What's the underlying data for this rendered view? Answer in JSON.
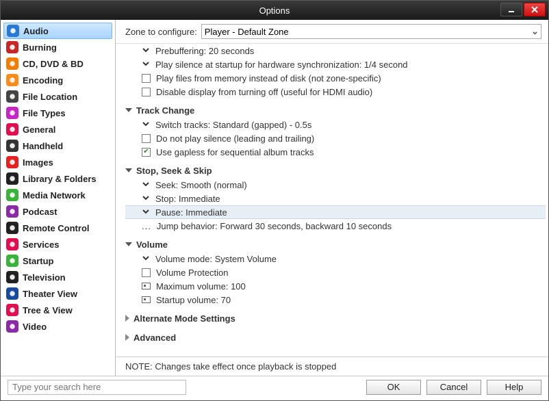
{
  "window": {
    "title": "Options"
  },
  "sidebar": {
    "items": [
      {
        "label": "Audio",
        "icon": "audio",
        "selected": true,
        "bg": "#2a7ad4"
      },
      {
        "label": "Burning",
        "icon": "burning",
        "bg": "#c62828"
      },
      {
        "label": "CD, DVD & BD",
        "icon": "disc",
        "bg": "#f57c00"
      },
      {
        "label": "Encoding",
        "icon": "encoding",
        "bg": "#ff8c1a"
      },
      {
        "label": "File Location",
        "icon": "file-location",
        "bg": "#444"
      },
      {
        "label": "File Types",
        "icon": "file-types",
        "bg": "#c526c5"
      },
      {
        "label": "General",
        "icon": "general",
        "bg": "#e01050"
      },
      {
        "label": "Handheld",
        "icon": "handheld",
        "bg": "#333"
      },
      {
        "label": "Images",
        "icon": "images",
        "bg": "#e52222"
      },
      {
        "label": "Library & Folders",
        "icon": "library",
        "bg": "#222"
      },
      {
        "label": "Media Network",
        "icon": "media-network",
        "bg": "#3ab33a"
      },
      {
        "label": "Podcast",
        "icon": "podcast",
        "bg": "#8a2aa8"
      },
      {
        "label": "Remote Control",
        "icon": "remote",
        "bg": "#222"
      },
      {
        "label": "Services",
        "icon": "services",
        "bg": "#e01050"
      },
      {
        "label": "Startup",
        "icon": "startup",
        "bg": "#3ab33a"
      },
      {
        "label": "Television",
        "icon": "television",
        "bg": "#222"
      },
      {
        "label": "Theater View",
        "icon": "theater",
        "bg": "#1a4aa0"
      },
      {
        "label": "Tree & View",
        "icon": "tree",
        "bg": "#e01050"
      },
      {
        "label": "Video",
        "icon": "video",
        "bg": "#8a2aa8"
      }
    ]
  },
  "zone": {
    "label": "Zone to configure:",
    "value": "Player - Default Zone"
  },
  "settings": {
    "loose": [
      {
        "type": "expand",
        "text": "Prebuffering: 20 seconds"
      },
      {
        "type": "expand",
        "text": "Play silence at startup for hardware synchronization: 1/4 second"
      },
      {
        "type": "check",
        "checked": false,
        "text": "Play files from memory instead of disk (not zone-specific)"
      },
      {
        "type": "check",
        "checked": false,
        "text": "Disable display from turning off (useful for HDMI audio)"
      }
    ],
    "groups": [
      {
        "title": "Track Change",
        "open": true,
        "rows": [
          {
            "type": "expand",
            "text": "Switch tracks: Standard (gapped) - 0.5s"
          },
          {
            "type": "check",
            "checked": false,
            "text": "Do not play silence (leading and trailing)"
          },
          {
            "type": "check",
            "checked": true,
            "text": "Use gapless for sequential album tracks"
          }
        ]
      },
      {
        "title": "Stop, Seek & Skip",
        "open": true,
        "rows": [
          {
            "type": "expand",
            "text": "Seek: Smooth (normal)"
          },
          {
            "type": "expand",
            "text": "Stop: Immediate"
          },
          {
            "type": "expand",
            "text": "Pause: Immediate",
            "selected": true
          },
          {
            "type": "more",
            "text": "Jump behavior: Forward 30 seconds, backward 10 seconds"
          }
        ]
      },
      {
        "title": "Volume",
        "open": true,
        "rows": [
          {
            "type": "expand",
            "text": "Volume mode: System Volume"
          },
          {
            "type": "check",
            "checked": false,
            "text": "Volume Protection"
          },
          {
            "type": "rect",
            "text": "Maximum volume: 100"
          },
          {
            "type": "rect",
            "text": "Startup volume: 70"
          }
        ]
      },
      {
        "title": "Alternate Mode Settings",
        "open": false,
        "rows": []
      },
      {
        "title": "Advanced",
        "open": false,
        "rows": []
      }
    ]
  },
  "note": "NOTE: Changes take effect once playback is stopped",
  "footer": {
    "search_placeholder": "Type your search here",
    "ok": "OK",
    "cancel": "Cancel",
    "help": "Help"
  }
}
